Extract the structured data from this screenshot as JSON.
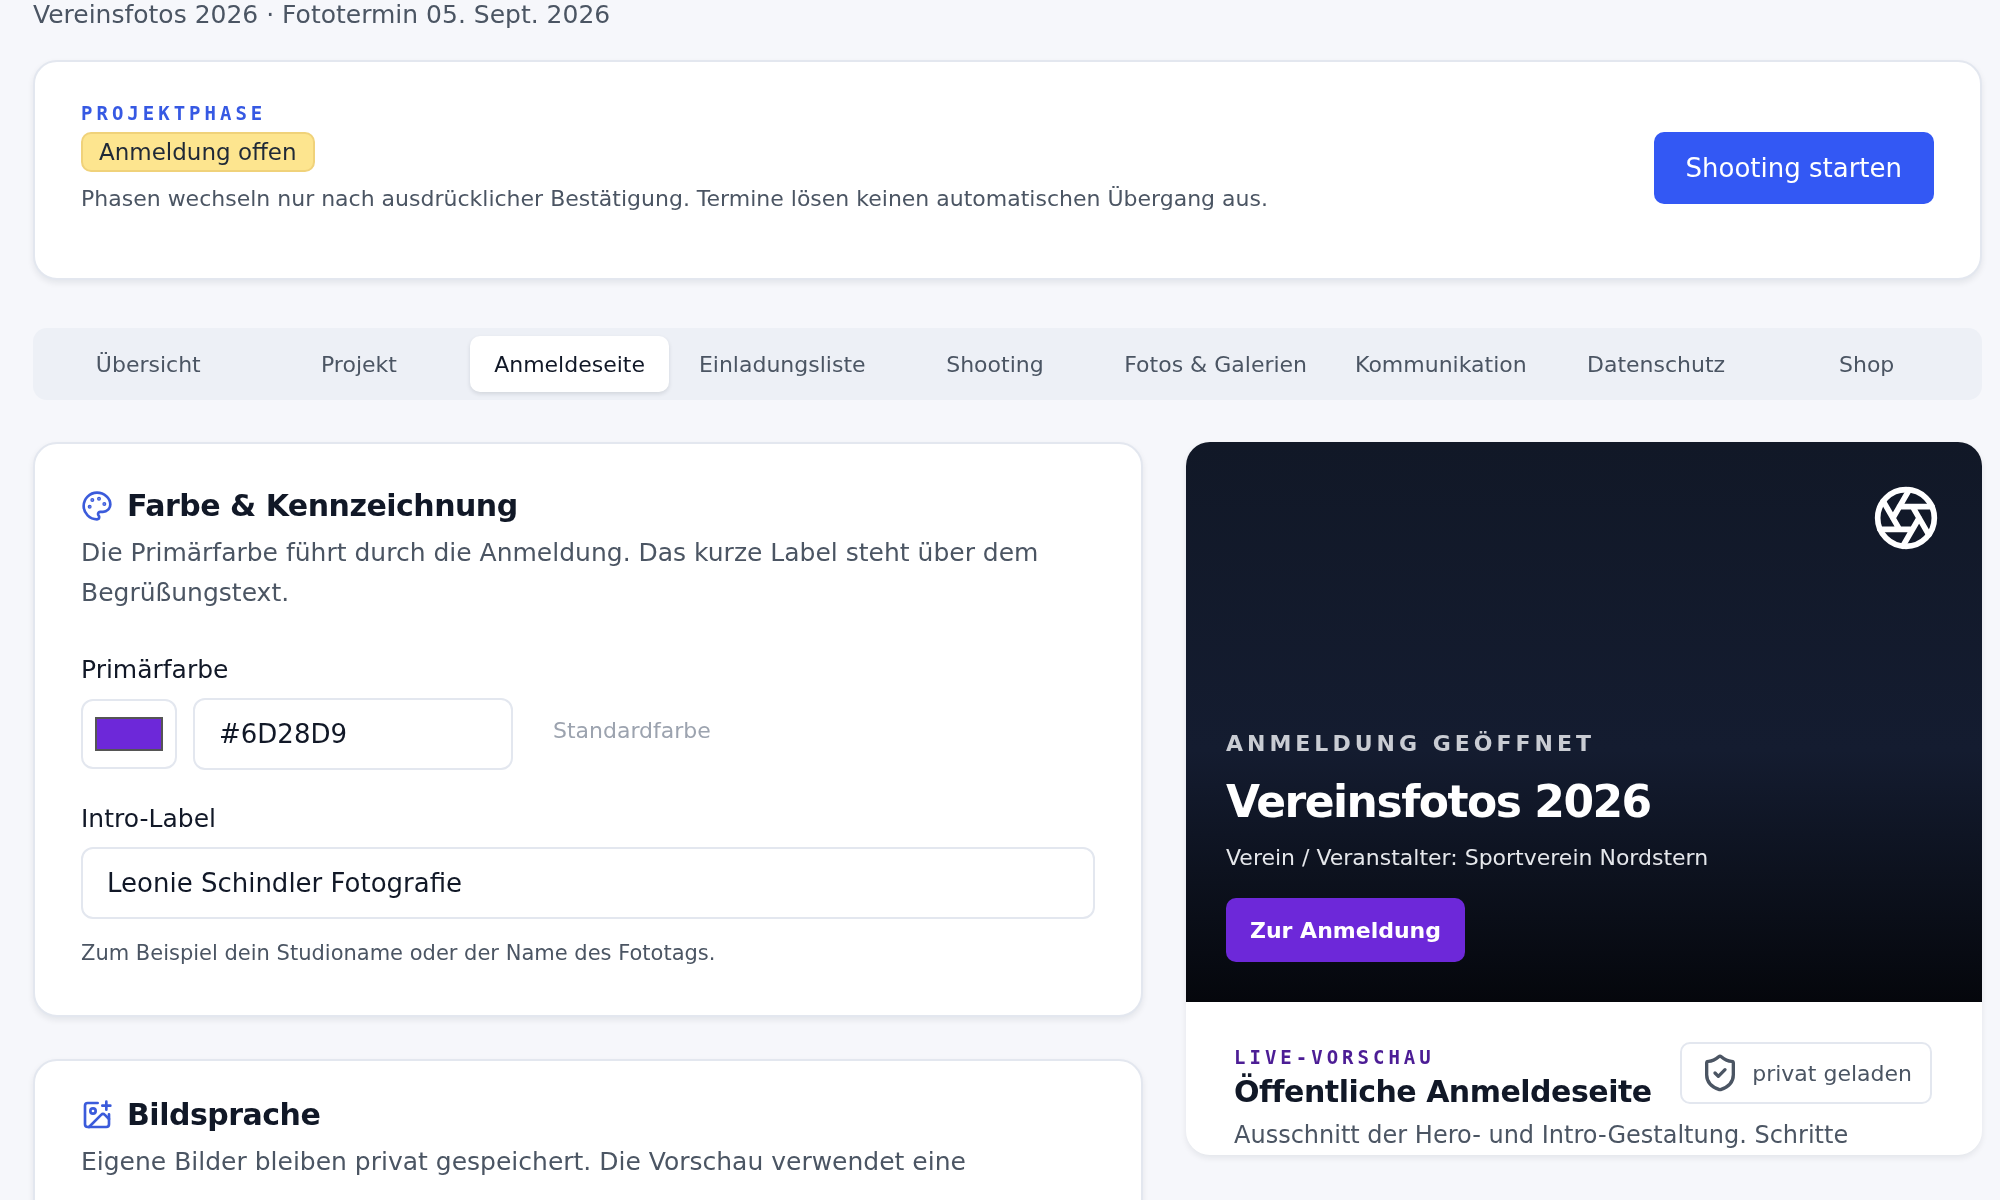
{
  "header": {
    "subtitle": "Vereinsfotos 2026 · Fototermin 05. Sept. 2026"
  },
  "phase": {
    "label": "PROJEKTPHASE",
    "status": "Anmeldung offen",
    "note": "Phasen wechseln nur nach ausdrücklicher Bestätigung. Termine lösen keinen automatischen Übergang aus.",
    "button": "Shooting starten"
  },
  "tabs": [
    {
      "label": "Übersicht",
      "selected": false
    },
    {
      "label": "Projekt",
      "selected": false
    },
    {
      "label": "Anmeldeseite",
      "selected": true
    },
    {
      "label": "Einladungsliste",
      "selected": false
    },
    {
      "label": "Shooting",
      "selected": false
    },
    {
      "label": "Fotos & Galerien",
      "selected": false
    },
    {
      "label": "Kommunikation",
      "selected": false
    },
    {
      "label": "Datenschutz",
      "selected": false
    },
    {
      "label": "Shop",
      "selected": false
    }
  ],
  "color_card": {
    "title": "Farbe & Kennzeichnung",
    "description": "Die Primärfarbe führt durch die Anmeldung. Das kurze Label steht über dem Begrüßungstext.",
    "primary_label": "Primärfarbe",
    "hex_value": "#6D28D9",
    "default_link": "Standardfarbe",
    "intro_label": "Intro-Label",
    "intro_value": "Leonie Schindler Fotografie",
    "hint": "Zum Beispiel dein Studioname oder der Name des Fototags."
  },
  "image_card": {
    "title": "Bildsprache",
    "description": "Eigene Bilder bleiben privat gespeichert. Die Vorschau verwendet eine"
  },
  "preview": {
    "eyebrow": "ANMELDUNG GEÖFFNET",
    "title": "Vereinsfotos 2026",
    "organizer": "Verein / Veranstalter: Sportverein Nordstern",
    "button": "Zur Anmeldung",
    "label": "LIVE-VORSCHAU",
    "heading": "Öffentliche Anmeldeseite",
    "badge": "privat geladen",
    "description": "Ausschnitt der Hero- und Intro-Gestaltung. Schritte"
  }
}
